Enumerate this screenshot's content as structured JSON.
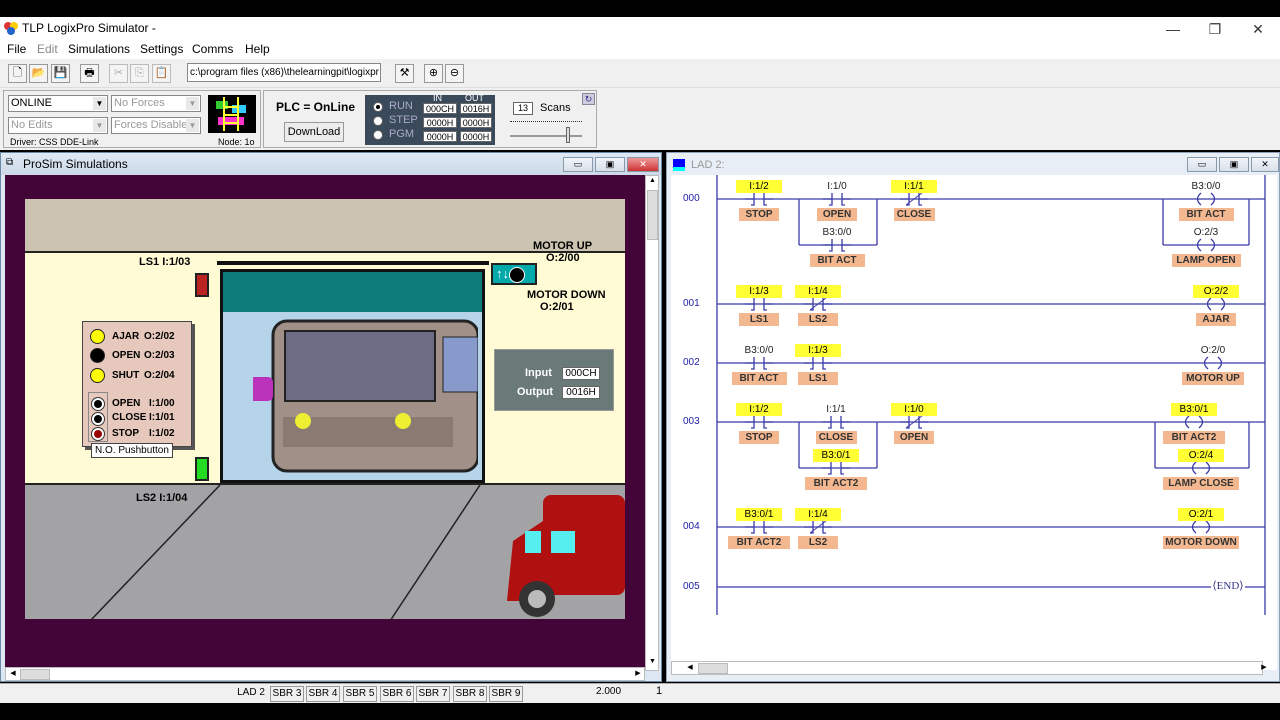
{
  "app": {
    "title": "TLP LogixPro Simulator  -"
  },
  "window_controls": {
    "minimize": "—",
    "restore": "❐",
    "close": "✕"
  },
  "menu": [
    "File",
    "Edit",
    "Simulations",
    "Settings",
    "Comms",
    "Help"
  ],
  "toolbar": {
    "icons": [
      "new-file-icon",
      "open-folder-icon",
      "save-icon",
      "print-icon",
      "cut-icon",
      "copy-icon",
      "paste-icon",
      "tools-icon",
      "zoom-in-icon",
      "zoom-out-icon"
    ],
    "path": "c:\\program files (x86)\\thelearningpit\\logixpr"
  },
  "panel": {
    "mode": "ONLINE",
    "forces": "No Forces",
    "edits": "No Edits",
    "forces_state": "Forces Disabled",
    "driver": "Driver: CSS DDE-Link",
    "node": "Node: 1o",
    "plc_status": "PLC = OnLine",
    "download": "DownLoad",
    "modes": [
      "RUN",
      "STEP",
      "PGM"
    ],
    "selected_mode": "RUN",
    "io_headers": [
      "IN",
      "OUT"
    ],
    "io_rows": [
      [
        "000CH",
        "0016H"
      ],
      [
        "0000H",
        "0000H"
      ],
      [
        "0000H",
        "0000H"
      ]
    ],
    "scans_value": "13",
    "scans_label": "Scans"
  },
  "sim": {
    "title": "ProSim Simulations",
    "ls1": "LS1  I:1/03",
    "ls2": "LS2   I:1/04",
    "motor_up": "MOTOR UP",
    "motor_up_addr": "O:2/00",
    "motor_down": "MOTOR DOWN",
    "motor_down_addr": "O:2/01",
    "lamps": [
      {
        "name": "AJAR",
        "addr": "O:2/02",
        "color": "#ffff00"
      },
      {
        "name": "OPEN",
        "addr": "O:2/03",
        "color": "#000000"
      },
      {
        "name": "SHUT",
        "addr": "O:2/04",
        "color": "#ffff00"
      }
    ],
    "buttons": [
      {
        "name": "OPEN",
        "addr": "I:1/00"
      },
      {
        "name": "CLOSE",
        "addr": "I:1/01"
      },
      {
        "name": "STOP",
        "addr": "I:1/02"
      }
    ],
    "tooltip": "N.O. Pushbutton",
    "plc_input_label": "Input",
    "plc_input": "000CH",
    "plc_output_label": "Output",
    "plc_output": "0016H"
  },
  "lad": {
    "title": "LAD 2:",
    "rungs": [
      {
        "no": "000"
      },
      {
        "no": "001"
      },
      {
        "no": "002"
      },
      {
        "no": "003"
      },
      {
        "no": "004"
      },
      {
        "no": "005"
      }
    ],
    "elements": [
      {
        "addr": "I:1/2",
        "desc": "STOP",
        "hl": true
      },
      {
        "addr": "I:1/0",
        "desc": "OPEN",
        "hl": false
      },
      {
        "addr": "I:1/1",
        "desc": "CLOSE",
        "hl": true
      },
      {
        "addr": "B3:0/0",
        "desc": "BIT ACT",
        "hl": false
      },
      {
        "addr": "B3:0/0",
        "desc": "BIT ACT",
        "hl": false
      },
      {
        "addr": "O:2/3",
        "desc": "LAMP OPEN",
        "hl": false
      },
      {
        "addr": "I:1/3",
        "desc": "LS1",
        "hl": true
      },
      {
        "addr": "I:1/4",
        "desc": "LS2",
        "hl": true
      },
      {
        "addr": "O:2/2",
        "desc": "AJAR",
        "hl": true
      },
      {
        "addr": "B3:0/0",
        "desc": "BIT ACT",
        "hl": false
      },
      {
        "addr": "I:1/3",
        "desc": "LS1",
        "hl": true
      },
      {
        "addr": "O:2/0",
        "desc": "MOTOR UP",
        "hl": false
      },
      {
        "addr": "I:1/2",
        "desc": "STOP",
        "hl": true
      },
      {
        "addr": "I:1/1",
        "desc": "CLOSE",
        "hl": false
      },
      {
        "addr": "I:1/0",
        "desc": "OPEN",
        "hl": true
      },
      {
        "addr": "B3:0/1",
        "desc": "BIT ACT2",
        "hl": true
      },
      {
        "addr": "B3:0/1",
        "desc": "BIT ACT2",
        "hl": true
      },
      {
        "addr": "O:2/4",
        "desc": "LAMP CLOSE",
        "hl": true
      },
      {
        "addr": "B3:0/1",
        "desc": "BIT ACT2",
        "hl": true
      },
      {
        "addr": "I:1/4",
        "desc": "LS2",
        "hl": true
      },
      {
        "addr": "O:2/1",
        "desc": "MOTOR DOWN",
        "hl": true
      }
    ],
    "end_label": "END"
  },
  "status": {
    "tabs": [
      "LAD 2",
      "SBR 3",
      "SBR 4",
      "SBR 5",
      "SBR 6",
      "SBR 7",
      "SBR 8",
      "SBR 9"
    ],
    "active_tab": "LAD 2",
    "value": "2.000",
    "page": "1"
  }
}
